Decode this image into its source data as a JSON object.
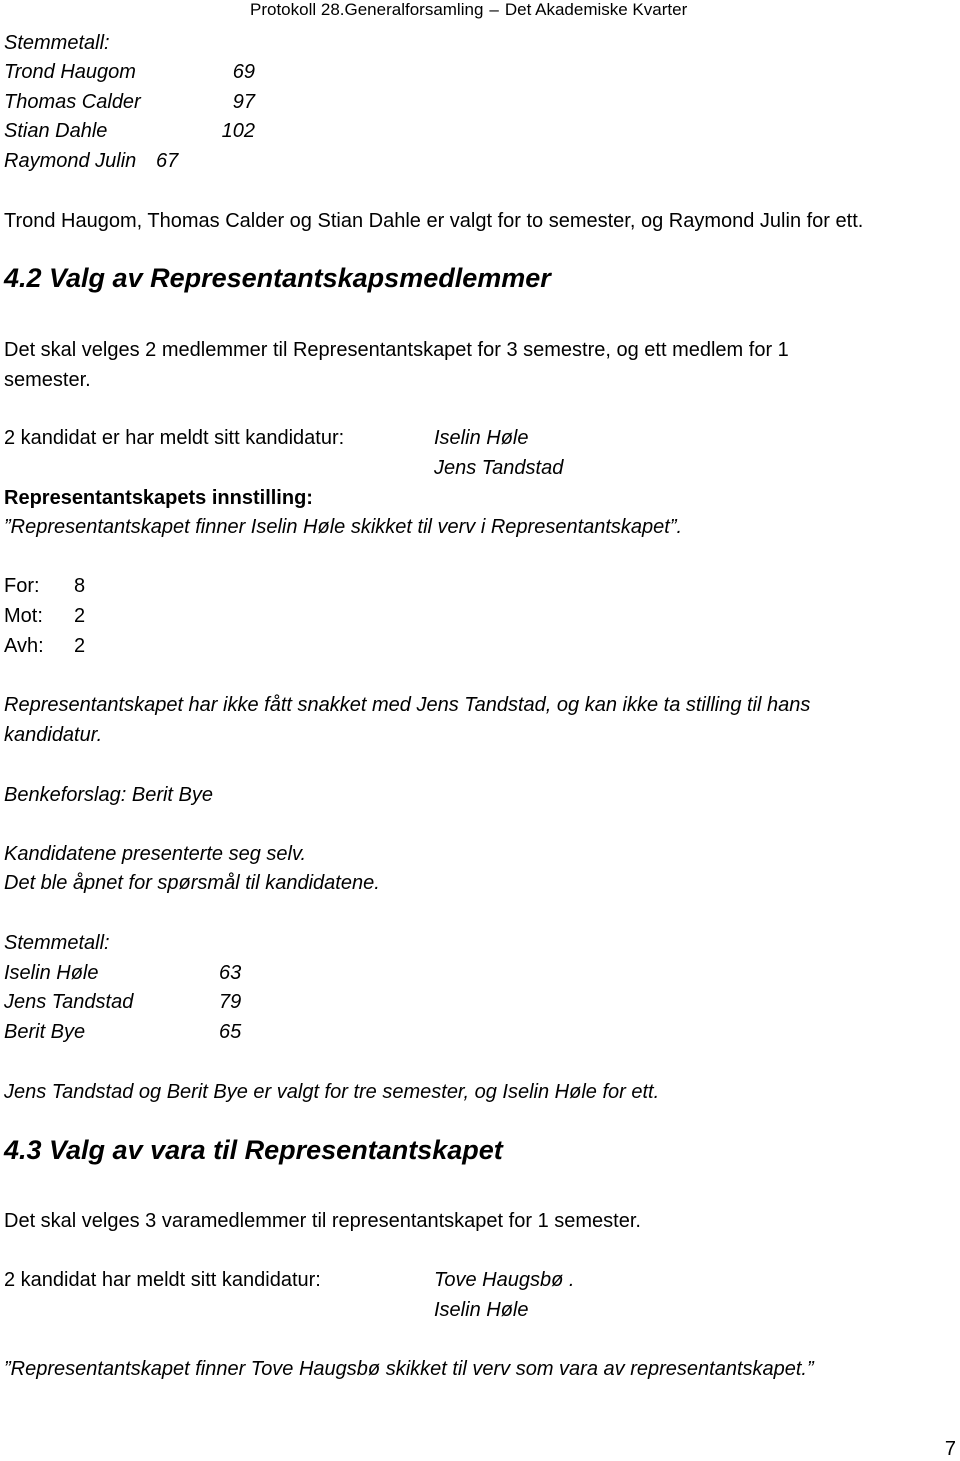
{
  "header": {
    "left": "Protokoll 28.Generalforsamling",
    "separator": "–",
    "right": "Det Akademiske Kvarter"
  },
  "votes1": {
    "title": "Stemmetall:",
    "rows": [
      {
        "name": "Trond Haugom",
        "votes": "69"
      },
      {
        "name": "Thomas Calder",
        "votes": "97"
      },
      {
        "name": "Stian Dahle",
        "votes": "102"
      },
      {
        "name": "Raymond Julin",
        "votes": "67"
      }
    ]
  },
  "result1": "Trond Haugom, Thomas Calder og Stian Dahle er valgt for to semester, og Raymond Julin for ett.",
  "section42": {
    "heading": "4.2 Valg av Representantskapsmedlemmer",
    "intro_line1": "Det skal velges 2 medlemmer til Representantskapet for 3 semestre, og ett medlem for 1",
    "intro_line2": "semester.",
    "candidates_label": "2  kandidat er har meldt sitt kandidatur:",
    "candidates": [
      "Iselin Høle",
      "Jens Tandstad"
    ],
    "recommendation_label": "Representantskapets innstilling:",
    "recommendation": "”Representantskapet finner Iselin Høle skikket til verv i Representantskapet”.",
    "tally": [
      {
        "label": "For:",
        "value": "8"
      },
      {
        "label": "Mot:",
        "value": "2"
      },
      {
        "label": "Avh:",
        "value": "2"
      }
    ],
    "note_line1": "Representantskapet har ikke fått snakket med Jens Tandstad, og kan ikke ta stilling til hans",
    "note_line2": "kandidatur.",
    "bench_proposal": "Benkeforslag: Berit Bye",
    "presentation1": "Kandidatene presenterte seg selv.",
    "presentation2": "Det ble åpnet for spørsmål til kandidatene.",
    "votes": {
      "title": "Stemmetall:",
      "rows": [
        {
          "name": "Iselin Høle",
          "votes": "63"
        },
        {
          "name": "Jens Tandstad",
          "votes": "79"
        },
        {
          "name": "Berit Bye",
          "votes": "65"
        }
      ]
    },
    "result": "Jens Tandstad og Berit Bye er valgt for tre semester, og Iselin Høle  for ett."
  },
  "section43": {
    "heading": "4.3 Valg av vara til Representantskapet",
    "intro": "Det skal velges 3 varamedlemmer til representantskapet for 1 semester.",
    "candidates_label": "2 kandidat har meldt sitt kandidatur:",
    "candidates": [
      "Tove Haugsbø .",
      "Iselin Høle"
    ],
    "recommendation": "”Representantskapet finner Tove Haugsbø skikket til verv som vara av representantskapet.”"
  },
  "page_number": "7"
}
